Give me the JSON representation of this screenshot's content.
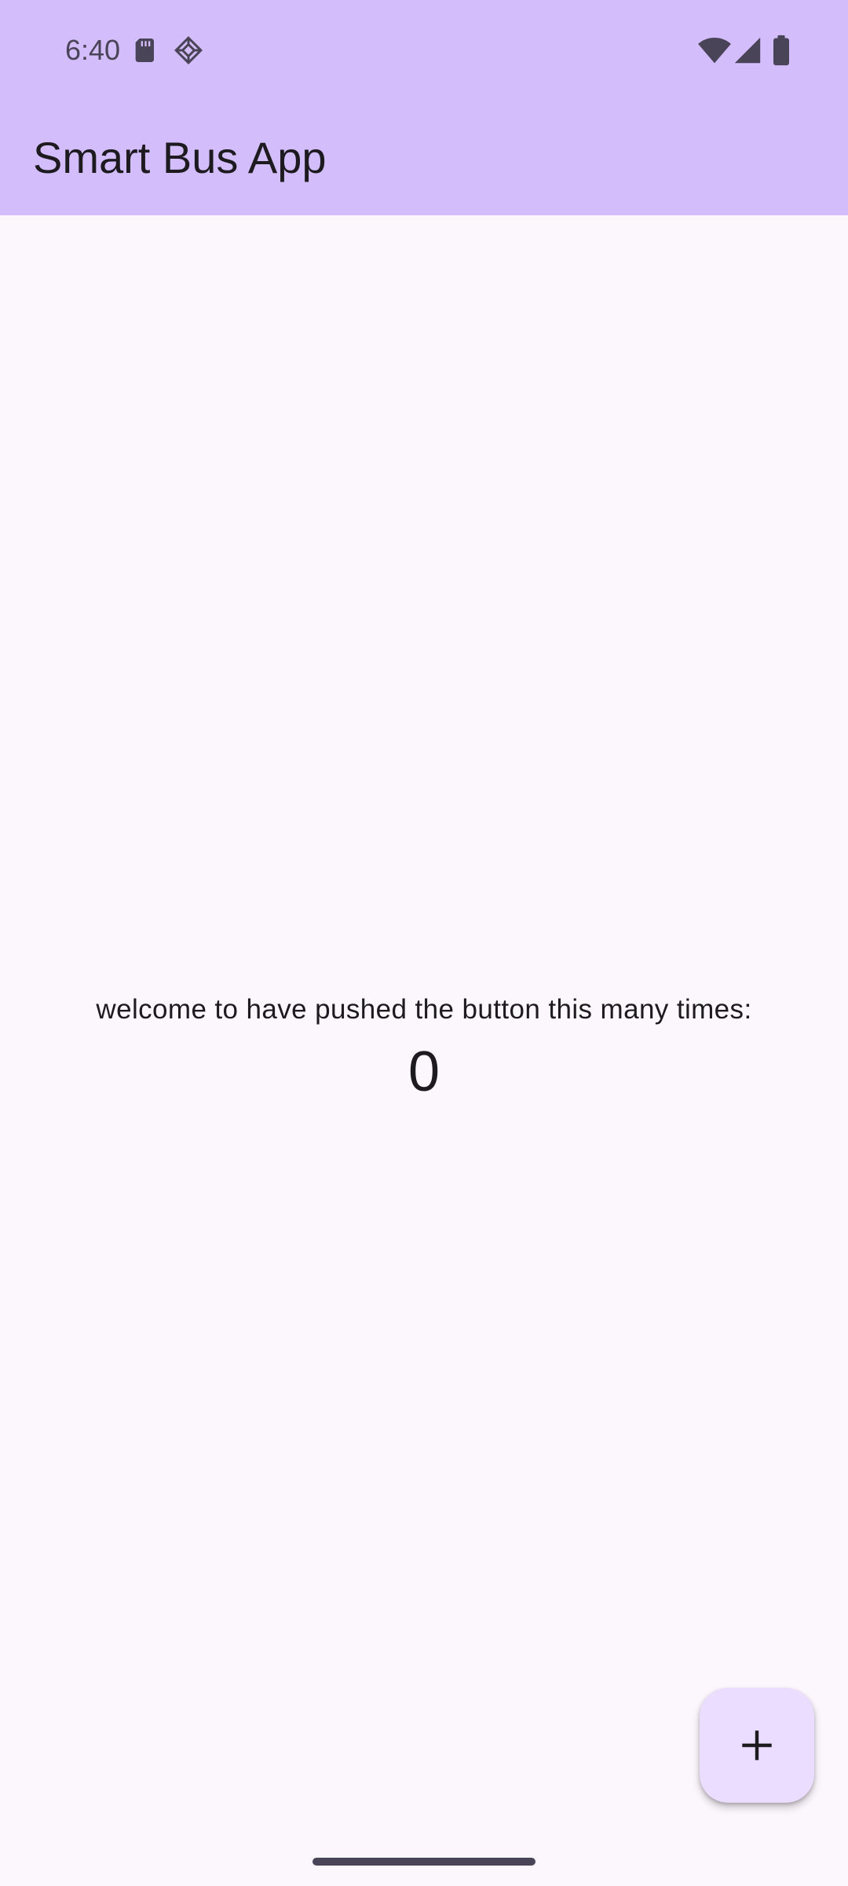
{
  "status_bar": {
    "time": "6:40",
    "left_icons": [
      "sd-card-icon",
      "ar-core-icon"
    ],
    "right_icons": [
      "wifi-icon",
      "cellular-signal-icon",
      "battery-icon"
    ]
  },
  "app_bar": {
    "title": "Smart Bus App"
  },
  "main": {
    "message": "welcome to have pushed the button this many times:",
    "counter": "0"
  },
  "fab": {
    "icon": "plus-icon"
  },
  "colors": {
    "app_bar_background": "#D3BEFB",
    "page_background": "#FCF6FD",
    "fab_background": "#EADDFF",
    "text": "#1D1B20"
  }
}
